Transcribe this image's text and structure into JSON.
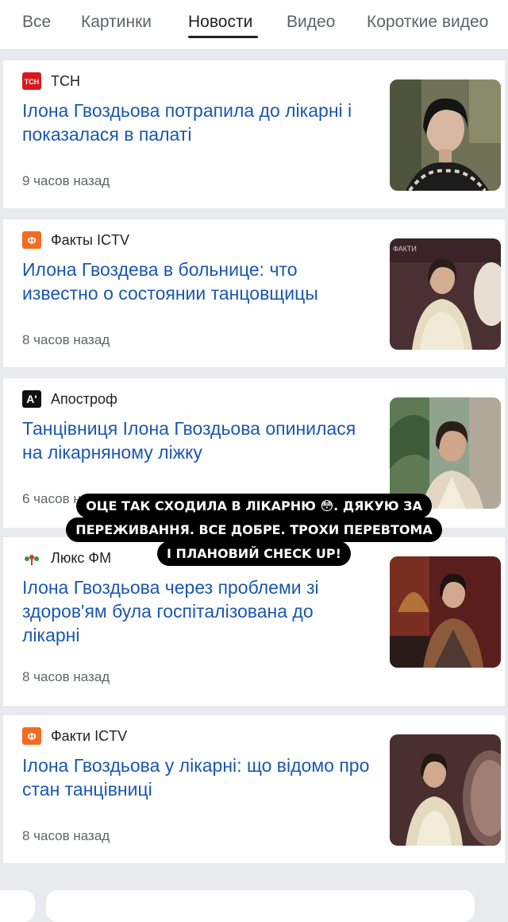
{
  "tabs": [
    "Все",
    "Картинки",
    "Новости",
    "Видео",
    "Короткие видео"
  ],
  "active_tab": "Новости",
  "articles": [
    {
      "source": "ТСН",
      "source_icon": "tsn-logo-icon",
      "headline": "Ілона Гвоздьова потрапила до лікарні і показалася в палаті",
      "time": "9 часов назад"
    },
    {
      "source": "Факты ICTV",
      "source_icon": "ictv-logo-icon",
      "headline": "Илона Гвоздева в больнице: что известно о состоянии танцовщицы",
      "time": "8 часов назад"
    },
    {
      "source": "Апостроф",
      "source_icon": "apostrof-logo-icon",
      "headline": "Танцівниця Ілона Гвоздьова опинилася на лікарняному ліжку",
      "time": "6 часов назад"
    },
    {
      "source": "Люкс ФМ",
      "source_icon": "luxfm-logo-icon",
      "headline": "Ілона Гвоздьова через проблеми зі здоров'ям була госпіталізована до лікарні",
      "time": "8 часов назад"
    },
    {
      "source": "Факти ICTV",
      "source_icon": "ictv-logo-icon",
      "headline": "Ілона Гвоздьова у лікарні: що відомо про стан танцівниці",
      "time": "8 часов назад"
    }
  ],
  "story_overlay": {
    "line1": "ОЦЕ ТАК СХОДИЛА В ЛІКАРНЮ 😳. ДЯКУЮ ЗА",
    "line2": "ПЕРЕЖИВАННЯ. ВСЕ ДОБРЕ. ТРОХИ ПЕРЕВТОМА",
    "line3": "І ПЛАНОВИЙ CHECK UP!"
  },
  "colors": {
    "headline": "#1a57b0",
    "tsn_red": "#d7191f",
    "ictv_orange": "#f26b21"
  }
}
